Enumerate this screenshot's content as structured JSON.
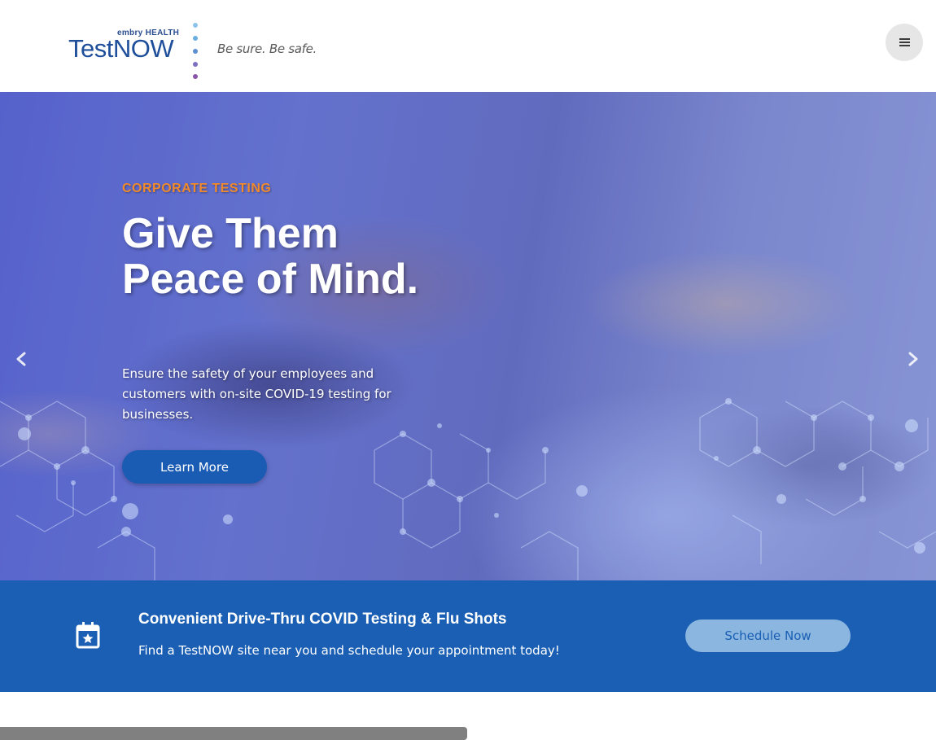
{
  "header": {
    "logo": {
      "small_text": "embry HEALTH",
      "main_text": "TestNOW",
      "tagline": "Be sure. Be safe.",
      "dot_colors": [
        "#8bc4e8",
        "#6aaee0",
        "#5b8fd0",
        "#7b6fc0",
        "#8a55a8"
      ]
    },
    "menu_icon": "hamburger-icon"
  },
  "hero": {
    "eyebrow": "CORPORATE TESTING",
    "title": "Give Them Peace of Mind.",
    "description": "Ensure the safety of your employees and customers with on-site COVID-19 testing for businesses.",
    "button_label": "Learn More",
    "prev_icon": "chevron-left-icon",
    "next_icon": "chevron-right-icon"
  },
  "banner": {
    "icon": "calendar-star-icon",
    "title": "Convenient Drive-Thru COVID Testing & Flu Shots",
    "subtitle": "Find a TestNOW site near you and schedule your appointment today!",
    "button_label": "Schedule Now"
  },
  "colors": {
    "brand_blue": "#1a5fb4",
    "accent_orange": "#f08a2c",
    "button_light": "#8ab6e0"
  }
}
